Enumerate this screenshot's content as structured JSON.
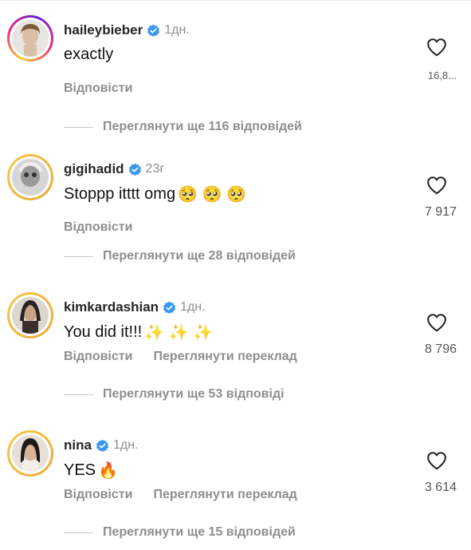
{
  "comments": [
    {
      "username": "haileybieber",
      "time": "1дн.",
      "text": "exactly",
      "emoji": "",
      "actions": [
        "Відповісти"
      ],
      "replies": "Переглянути ще 116 відповідей",
      "likes": "16,8..."
    },
    {
      "username": "gigihadid",
      "time": "23г",
      "text": "Stoppp itttt omg",
      "emoji": "🥺 🥺 🥺",
      "actions": [
        "Відповісти"
      ],
      "replies": "Переглянути ще 28 відповідей",
      "likes": "7 917"
    },
    {
      "username": "kimkardashian",
      "time": "1дн.",
      "text": "You did it!!!",
      "emoji": "✨ ✨ ✨",
      "actions": [
        "Відповісти",
        "Переглянути переклад"
      ],
      "replies": "Переглянути ще 53 відповіді",
      "likes": "8 796"
    },
    {
      "username": "nina",
      "time": "1дн.",
      "text": "YES",
      "emoji": "🔥",
      "actions": [
        "Відповісти",
        "Переглянути переклад"
      ],
      "replies": "Переглянути ще 15 відповідей",
      "likes": "3 614"
    }
  ],
  "colors": {
    "verified": "#3897f0",
    "secondary_text": "#8e8e8e",
    "primary_text": "#262626"
  },
  "icons": {
    "verified": "verified-badge-icon",
    "like": "heart-outline-icon"
  }
}
